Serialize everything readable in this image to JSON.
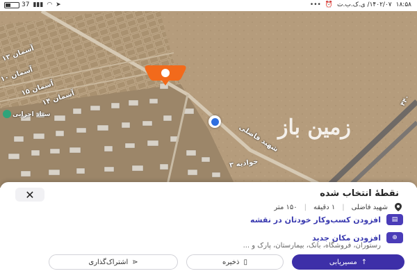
{
  "status_bar": {
    "time": "۱۸:۵۸",
    "date": "۱۴۰۲/۰۷/ ی.ک.ب.ت",
    "battery": "37",
    "battery_level": 0.37,
    "icons": [
      "alarm-clock-icon",
      "more-dots-icon",
      "location-arrow-icon",
      "wifi-icon",
      "signal-icon",
      "battery-icon"
    ]
  },
  "map": {
    "labels": [
      {
        "text": "آسمان ۱۰"
      },
      {
        "text": "آسمان ۱۵"
      },
      {
        "text": "آسمان ۱۳"
      },
      {
        "text": "آسمان ۱۴"
      },
      {
        "text": "ستاد اجرایی"
      },
      {
        "text": "شهید فاضلی"
      },
      {
        "text": "جوادیه ۳"
      },
      {
        "text": "۴۴۰"
      }
    ],
    "watermark": "زمین باز"
  },
  "sheet": {
    "close_icon": "close-icon",
    "title": "نقطهٔ انتخاب شده",
    "meta": {
      "place": "شهید فاضلی",
      "time": "۱ دقیقه",
      "distance": "۱۵۰ متر"
    },
    "add_business": "افزودن کسب‌وکار خودتان در نقشه",
    "add_place": "افزودن مکان جدید",
    "add_place_sub": "رستوران، فروشگاه، بانک، بیمارستان، پارک و ...",
    "buttons": {
      "route": "مسیریابی",
      "save": "ذخیره",
      "share": "اشتراک‌گذاری"
    }
  },
  "colors": {
    "accent": "#3d2fa8",
    "marker": "#f26a1b",
    "location_dot": "#2f6fe0"
  }
}
